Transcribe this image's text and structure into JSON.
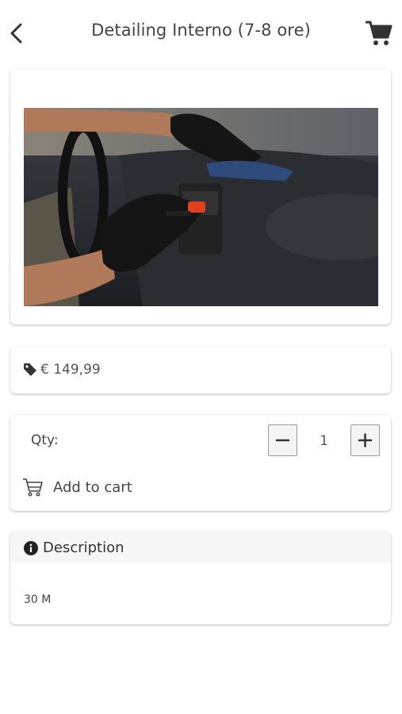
{
  "header": {
    "title": "Detailing Interno (7-8 ore)",
    "back_icon": "chevron-left-icon",
    "cart_icon": "shopping-cart-icon"
  },
  "product": {
    "image_alt": "interior car detailing photo",
    "price": "€ 149,99",
    "price_icon": "price-tag-icon"
  },
  "quantity": {
    "label": "Qty:",
    "value": "1",
    "decrement_symbol": "−",
    "increment_symbol": "+"
  },
  "add_to_cart": {
    "label": "Add to cart",
    "icon": "cart-outline-icon"
  },
  "description": {
    "title": "Description",
    "icon": "info-icon",
    "text": "30 M"
  },
  "colors": {
    "text": "#444444",
    "header_bg": "#f6f6f6",
    "button_bg": "#f4f4f4",
    "icon": "#222222"
  }
}
